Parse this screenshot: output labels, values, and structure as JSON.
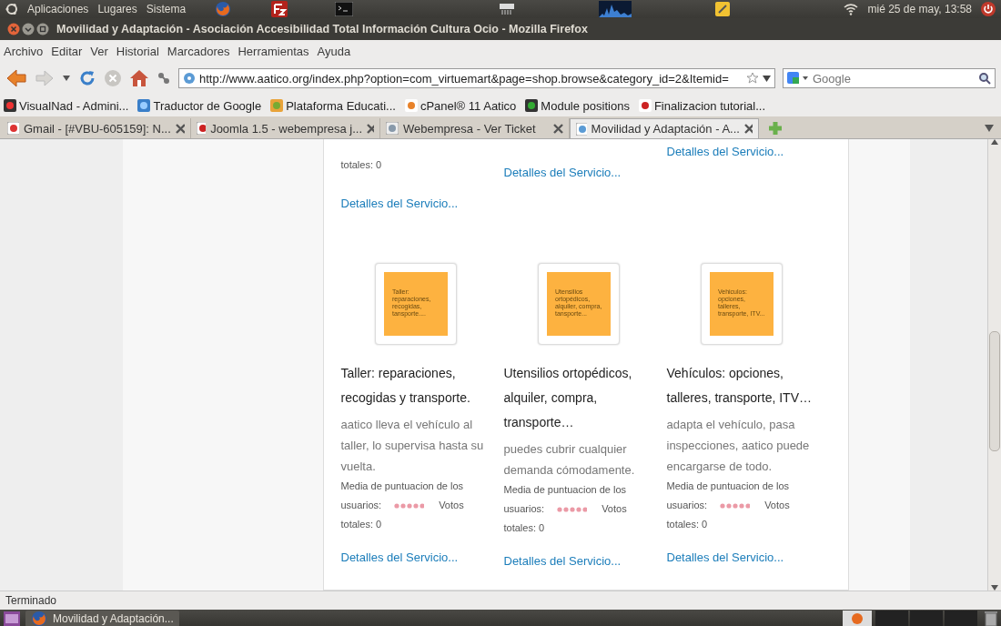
{
  "top_panel": {
    "menus": [
      "Aplicaciones",
      "Lugares",
      "Sistema"
    ],
    "clock": "mié 25 de may, 13:58"
  },
  "window": {
    "title": "Movilidad y Adaptación - Asociación Accesibilidad Total Información Cultura Ocio - Mozilla Firefox"
  },
  "menu_bar": [
    "Archivo",
    "Editar",
    "Ver",
    "Historial",
    "Marcadores",
    "Herramientas",
    "Ayuda"
  ],
  "toolbar": {
    "url": "http://www.aatico.org/index.php?option=com_virtuemart&page=shop.browse&category_id=2&Itemid=",
    "search_placeholder": "Google"
  },
  "bookmarks": [
    {
      "label": "VisualNad - Admini..."
    },
    {
      "label": "Traductor de Google"
    },
    {
      "label": "Plataforma Educati..."
    },
    {
      "label": "cPanel® 11 Aatico"
    },
    {
      "label": "Module positions"
    },
    {
      "label": "Finalizacion tutorial..."
    }
  ],
  "tabs": [
    {
      "label": "Gmail - [#VBU-605159]: N...",
      "selected": false
    },
    {
      "label": "Joomla 1.5 - webempresa j...",
      "selected": false
    },
    {
      "label": "Webempresa - Ver Ticket",
      "selected": false
    },
    {
      "label": "Movilidad y Adaptación - A...",
      "selected": true
    }
  ],
  "previous_row": [
    {
      "votes": "totales: 0",
      "link": "Detalles del Servicio..."
    },
    {
      "link": "Detalles del Servicio..."
    },
    {
      "link": "Detalles del Servicio..."
    }
  ],
  "products": [
    {
      "thumb_text": "Taller: reparaciones, recogidas, tansporte....",
      "title": "Taller: reparaciones, recogidas y transporte.",
      "description": "aatico lleva el vehículo al taller, lo supervisa hasta su vuelta.",
      "rating_lines": [
        "Media de puntuacion de los",
        "usuarios:"
      ],
      "votes_lines": [
        "Votos",
        "totales: 0"
      ],
      "link": "Detalles del Servicio..."
    },
    {
      "thumb_text": "Utensilios ortopédicos, alquiler, compra, tansporte...",
      "title": "Utensilios ortopédicos, alquiler, compra, transporte…",
      "description": "puedes cubrir cualquier demanda cómodamente.",
      "rating_lines": [
        "Media de puntuacion de los",
        "usuarios:"
      ],
      "votes_lines": [
        "Votos",
        "totales: 0"
      ],
      "link": "Detalles del Servicio..."
    },
    {
      "thumb_text": "Vehiculos: opciones, talleres, transporte, ITV...",
      "title": "Vehículos: opciones, talleres, transporte, ITV…",
      "description": "adapta el vehículo, pasa inspecciones, aatico puede encargarse de todo.",
      "rating_lines": [
        "Media de puntuacion de los",
        "usuarios:"
      ],
      "votes_lines": [
        "Votos",
        "totales: 0"
      ],
      "link": "Detalles del Servicio..."
    }
  ],
  "status_bar": "Terminado",
  "taskbar": {
    "window": "Movilidad y Adaptación..."
  }
}
